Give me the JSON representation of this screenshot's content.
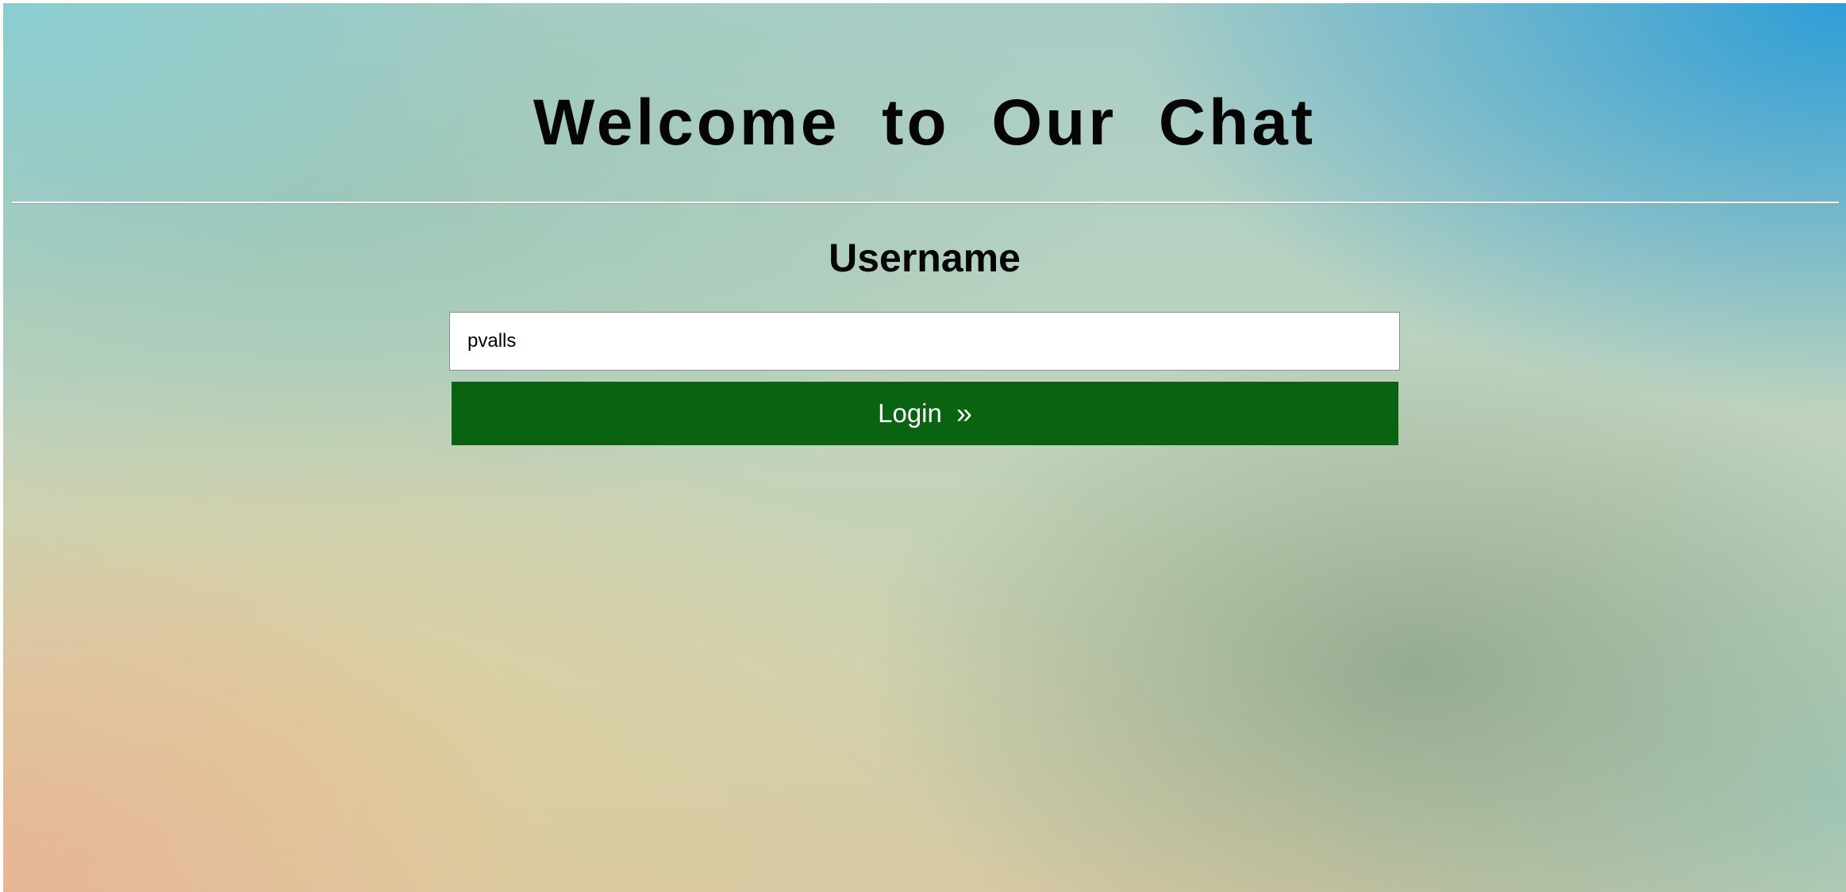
{
  "page": {
    "title": "Welcome to Our Chat"
  },
  "login_form": {
    "label": "Username",
    "username_value": "pvalls",
    "login_label": "Login",
    "login_icon": "double-chevron-right-icon",
    "login_glyph": "»",
    "button_color": "#0a6310"
  }
}
